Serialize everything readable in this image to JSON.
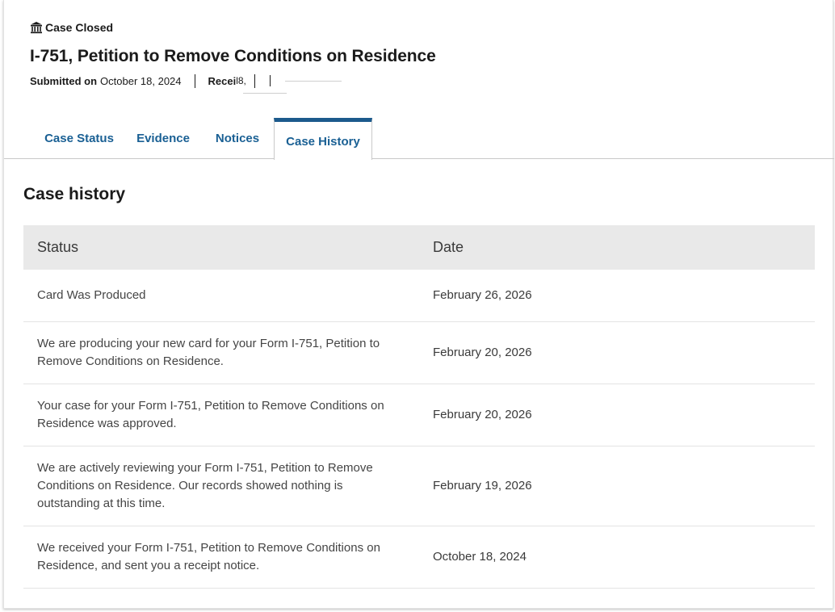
{
  "case": {
    "status_label": "Case Closed",
    "status_icon": "bank-building-icon",
    "title": "I-751, Petition to Remove Conditions on Residence",
    "submitted_label": "Submitted on",
    "submitted_date": "October 18, 2024",
    "receipt_label": "Recei",
    "receipt_partial": "l8,"
  },
  "tabs": [
    {
      "label": "Case Status",
      "active": false
    },
    {
      "label": "Evidence",
      "active": false
    },
    {
      "label": "Notices",
      "active": false
    },
    {
      "label": "Case History",
      "active": true
    }
  ],
  "history": {
    "heading": "Case history",
    "columns": [
      "Status",
      "Date"
    ],
    "rows": [
      {
        "status": "Card Was Produced",
        "date": "February 26, 2026"
      },
      {
        "status": "We are producing your new card for your Form I-751, Petition to Remove Conditions on Residence.",
        "date": "February 20, 2026"
      },
      {
        "status": "Your case for your Form I-751, Petition to Remove Conditions on Residence was approved.",
        "date": "February 20, 2026"
      },
      {
        "status": "We are actively reviewing your Form I-751, Petition to Remove Conditions on Residence. Our records showed nothing is outstanding at this time.",
        "date": "February 19, 2026"
      },
      {
        "status": "We received your Form I-751, Petition to Remove Conditions on Residence, and sent you a receipt notice.",
        "date": "October 18, 2024"
      }
    ]
  },
  "colors": {
    "tab_text": "#1a6094",
    "tab_active_border": "#1c5a8c",
    "table_header_bg": "#e9e9e9"
  }
}
